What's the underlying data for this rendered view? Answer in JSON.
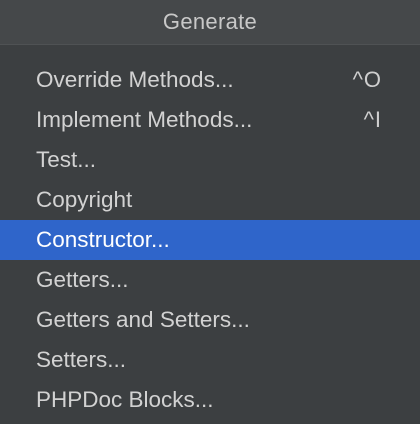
{
  "popup": {
    "title": "Generate",
    "items": [
      {
        "label": "Override Methods...",
        "shortcut": "^O",
        "selected": false
      },
      {
        "label": "Implement Methods...",
        "shortcut": "^I",
        "selected": false
      },
      {
        "label": "Test...",
        "shortcut": "",
        "selected": false
      },
      {
        "label": "Copyright",
        "shortcut": "",
        "selected": false
      },
      {
        "label": "Constructor...",
        "shortcut": "",
        "selected": true
      },
      {
        "label": "Getters...",
        "shortcut": "",
        "selected": false
      },
      {
        "label": "Getters and Setters...",
        "shortcut": "",
        "selected": false
      },
      {
        "label": "Setters...",
        "shortcut": "",
        "selected": false
      },
      {
        "label": "PHPDoc Blocks...",
        "shortcut": "",
        "selected": false
      }
    ]
  },
  "colors": {
    "background": "#3c3f41",
    "header_background": "#45484a",
    "selection": "#2f65ca",
    "text": "#d2d2d2"
  }
}
